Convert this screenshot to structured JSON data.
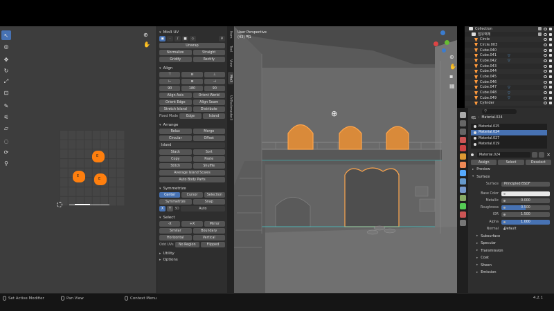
{
  "status_bar": {
    "left_action": "Set Active Modifier",
    "middle_action": "Pan View",
    "right_action": "Context Menu",
    "version": "4.2.1"
  },
  "uv_editor": {
    "island_labels": [
      "E",
      "E",
      "E"
    ]
  },
  "side_panel": {
    "addon_title": "Mio3 UV",
    "unwrap_label": "Unwrap",
    "normalize_label": "Normalize",
    "straight_label": "Straight",
    "gridify_label": "Gridify",
    "rectify_label": "Rectify",
    "align_header": "Align",
    "rot_90_ccw": "90",
    "rot_180": "180",
    "rot_90_cw": "90",
    "align_axis": "Align Axis",
    "orient_world": "Orient World",
    "orient_edge": "Orient Edge",
    "align_seam": "Align Seam",
    "stretch_island": "Stretch Island",
    "distribute": "Distribute",
    "fixed_mode_label": "Fixed Mode",
    "fixed_mode_value": "Edge",
    "fixed_mode_value2": "Island",
    "arrange_header": "Arrange",
    "relax": "Relax",
    "merge": "Merge",
    "circular": "Circular",
    "offset": "Offset",
    "island_dropdown": "Island",
    "stack": "Stack",
    "sort": "Sort",
    "copy": "Copy",
    "paste": "Paste",
    "stitch": "Stitch",
    "shuffle": "Shuffle",
    "average_island_scales": "Average Island Scales",
    "auto_body_parts": "Auto Body Parts",
    "symmetrize_header": "Symmetrize",
    "sym_center": "Center",
    "sym_cursor": "Cursor",
    "sym_selection": "Selection",
    "symmetrize_btn": "Symmetrize",
    "snap_btn": "Snap",
    "axis_x": "X",
    "axis_y": "Y",
    "mode_3d": "3D",
    "auto_label": "Auto",
    "select_header": "Select",
    "neg_x": "-X",
    "pos_x": "+X",
    "mirror": "Mirror",
    "similar": "Similar",
    "boundary": "Boundary",
    "horizontal": "Horizontal",
    "vertical": "Vertical",
    "odd_uvs": "Odd UVs",
    "no_region": "No Region",
    "flipped": "Flipped",
    "utility_header": "Utility",
    "options_header": "Options"
  },
  "vertical_tabs": [
    "Item",
    "Tool",
    "View",
    "Mio3",
    "UVPackmaster3"
  ],
  "viewport": {
    "title_line1": "User Perspective",
    "title_line2": "(43) 벽1"
  },
  "outliner": {
    "rows": [
      "Collection",
      "점유벽체",
      "Circle",
      "Circle.003",
      "Cube.040",
      "Cube.041",
      "Cube.042",
      "Cube.043",
      "Cube.044",
      "Cube.045",
      "Cube.046",
      "Cube.047",
      "Cube.048",
      "Cube.049",
      "Cylinder"
    ]
  },
  "properties": {
    "search_placeholder": "",
    "breadcrumb_obj": "벽1",
    "breadcrumb_mat": "Material.024",
    "materials": [
      "Material.025",
      "Material.024",
      "Material.027",
      "Material.019"
    ],
    "material_name": "Material.024",
    "assign": "Assign",
    "select": "Select",
    "deselect": "Deselect",
    "preview": "Preview",
    "surface_sec": "Surface",
    "surface_label": "Surface",
    "surface_value": "Principled BSDF",
    "base_color": "Base Color",
    "metallic": "Metallic",
    "metallic_value": "0.000",
    "roughness": "Roughness",
    "roughness_value": "0.500",
    "ior": "IOR",
    "ior_value": "1.500",
    "alpha": "Alpha",
    "alpha_value": "1.000",
    "normal": "Normal",
    "normal_value": "Default",
    "subsurface": "Subsurface",
    "specular": "Specular",
    "transmission": "Transmission",
    "coat": "Coat",
    "sheen": "Sheen",
    "emission": "Emission"
  },
  "colors": {
    "accent": "#4772b3",
    "uv_island": "#ff7f0e",
    "selection_orange": "#ff9a3c"
  }
}
